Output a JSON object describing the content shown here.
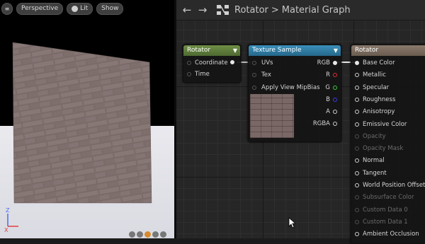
{
  "viewport": {
    "toolbar": {
      "perspective_label": "Perspective",
      "lit_label": "Lit",
      "show_label": "Show"
    },
    "axis_labels": {
      "z": "Z",
      "x": "X"
    }
  },
  "graph": {
    "nav_back_icon": "back-arrow-icon",
    "nav_forward_icon": "forward-arrow-icon",
    "breadcrumb": {
      "asset": "Rotator",
      "separator": ">",
      "view": "Material Graph"
    },
    "nodes": {
      "rotator": {
        "title": "Rotator",
        "header_color": "#5b7a3a",
        "inputs": [
          "Coordinate",
          "Time"
        ]
      },
      "texture_sample": {
        "title": "Texture Sample",
        "header_color": "#2e7da3",
        "inputs": [
          "UVs",
          "Tex",
          "Apply View MipBias"
        ],
        "outputs": [
          "RGB",
          "R",
          "G",
          "B",
          "A",
          "RGBA"
        ]
      },
      "material": {
        "title": "Rotator",
        "header_color": "#7a6b5e",
        "pins": [
          {
            "label": "Base Color",
            "enabled": true
          },
          {
            "label": "Metallic",
            "enabled": true
          },
          {
            "label": "Specular",
            "enabled": true
          },
          {
            "label": "Roughness",
            "enabled": true
          },
          {
            "label": "Anisotropy",
            "enabled": true
          },
          {
            "label": "Emissive Color",
            "enabled": true
          },
          {
            "label": "Opacity",
            "enabled": false
          },
          {
            "label": "Opacity Mask",
            "enabled": false
          },
          {
            "label": "Normal",
            "enabled": true
          },
          {
            "label": "Tangent",
            "enabled": true
          },
          {
            "label": "World Position Offset",
            "enabled": true
          },
          {
            "label": "Subsurface Color",
            "enabled": false
          },
          {
            "label": "Custom Data 0",
            "enabled": false
          },
          {
            "label": "Custom Data 1",
            "enabled": false
          },
          {
            "label": "Ambient Occlusion",
            "enabled": true
          }
        ]
      }
    }
  }
}
